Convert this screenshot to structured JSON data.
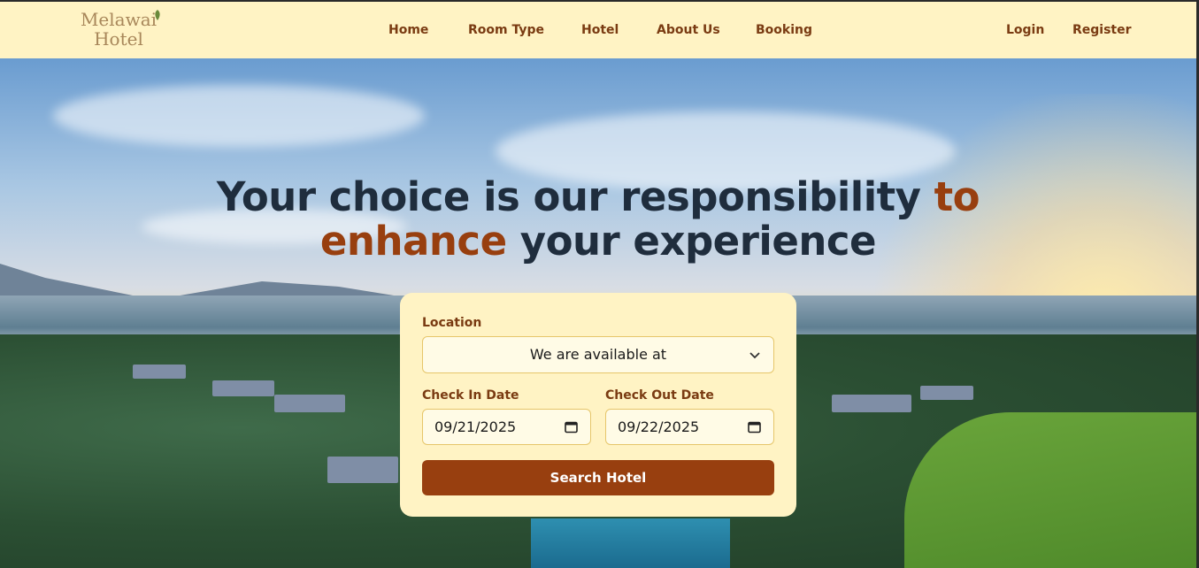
{
  "header": {
    "logo_line1": "Melawai",
    "logo_line2": "Hotel",
    "nav": [
      "Home",
      "Room Type",
      "Hotel",
      "About Us",
      "Booking"
    ],
    "auth": {
      "login": "Login",
      "register": "Register"
    }
  },
  "hero": {
    "headline_part1": "Your choice is our responsibility ",
    "headline_accent1": "to",
    "headline_accent2": "enhance",
    "headline_part2": " your experience"
  },
  "search": {
    "location_label": "Location",
    "location_value": "We are available at",
    "checkin_label": "Check In Date",
    "checkin_value": "09/21/2025",
    "checkout_label": "Check Out Date",
    "checkout_value": "09/22/2025",
    "button_label": "Search Hotel"
  },
  "colors": {
    "header_bg": "#fff3c4",
    "brand_brown": "#983f0f",
    "nav_text": "#7a3b12",
    "heading_navy": "#1f2d3d",
    "field_border": "#e6c66a"
  }
}
